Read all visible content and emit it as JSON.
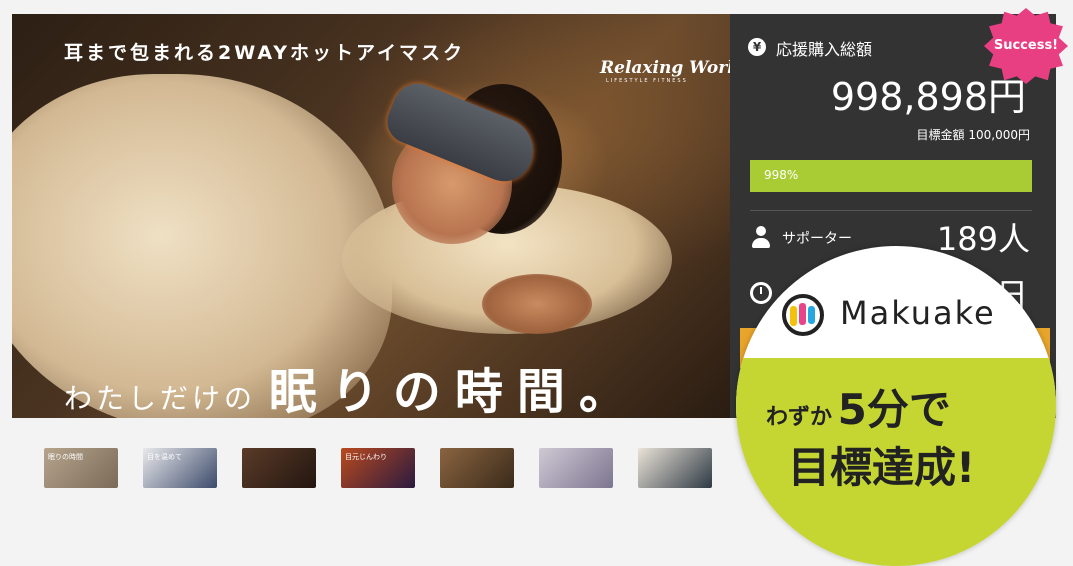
{
  "hero": {
    "tagline": "耳まで包まれる2WAYホットアイマスク",
    "brand": "Relaxing Work",
    "brand_sub": "LIFESTYLE FITNESS",
    "headline_prefix": "わたしだけの",
    "headline_main": "眠りの時間。"
  },
  "stats": {
    "total_label": "応援購入総額",
    "total_amount": "998,898円",
    "goal_label": "目標金額",
    "goal_amount": "100,000円",
    "progress_text": "998%",
    "progress_percent": 998,
    "supporters_label": "サポーター",
    "supporters_count": "189人",
    "remaining_unit": "日"
  },
  "badge": {
    "text": "Success!"
  },
  "promo": {
    "logo_text": "Makuake",
    "line1_prefix": "わずか",
    "line1_emphasis": "5分で",
    "line2": "目標達成!"
  },
  "thumbnails": [
    {
      "caption": "眠りの時間",
      "colors": [
        "#b6a48c",
        "#7a6a58"
      ]
    },
    {
      "caption": "目を温めて",
      "colors": [
        "#e9e9ec",
        "#3c4a6a"
      ]
    },
    {
      "caption": "",
      "colors": [
        "#5a3b28",
        "#231610"
      ]
    },
    {
      "caption": "目元じんわり",
      "colors": [
        "#b94a1e",
        "#2a1a40"
      ]
    },
    {
      "caption": "",
      "colors": [
        "#8a6440",
        "#3a2a1a"
      ]
    },
    {
      "caption": "",
      "colors": [
        "#cfc9d4",
        "#7c7590"
      ]
    },
    {
      "caption": "",
      "colors": [
        "#eae3d8",
        "#2e3a44"
      ]
    }
  ],
  "colors": {
    "sidebar_bg": "#333333",
    "progress_green": "#a9cc34",
    "promo_green": "#c5d632",
    "success_pink": "#e83f82"
  }
}
